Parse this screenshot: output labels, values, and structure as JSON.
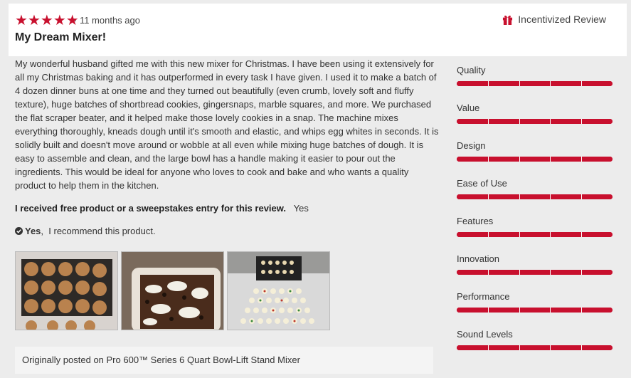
{
  "review": {
    "stars": 5,
    "time": "· 11 months ago",
    "title": "My Dream Mixer!",
    "incentivized_label": "Incentivized Review",
    "body": "My wonderful husband gifted me with this new mixer for Christmas. I have been using it extensively for all my Christmas baking and it has outperformed in every task I have given. I used it to make a batch of 4 dozen dinner buns at one time and they turned out beautifully (even crumb, lovely soft and fluffy texture), huge batches of shortbread cookies, gingersnaps, marble squares, and more. We purchased the flat scraper beater, and it helped make those lovely cookies in a snap. The machine mixes everything thoroughly, kneads dough until it's smooth and elastic, and whips egg whites in seconds. It is solidly built and doesn't move around or wobble at all even while mixing huge batches of dough. It is easy to assemble and clean, and the large bowl has a handle making it easier to pour out the ingredients. This would be ideal for anyone who loves to cook and bake and who wants a quality product to help them in the kitchen.",
    "disclosure_label": "I received free product or a sweepstakes entry for this review.",
    "disclosure_value": "Yes",
    "recommend_yes": "Yes",
    "recommend_text": "I recommend this product.",
    "origin": "Originally posted on Pro 600™ Series 6 Quart Bowl-Lift Stand Mixer"
  },
  "ratings": [
    {
      "label": "Quality",
      "value": 5
    },
    {
      "label": "Value",
      "value": 5
    },
    {
      "label": "Design",
      "value": 5
    },
    {
      "label": "Ease of Use",
      "value": 5
    },
    {
      "label": "Features",
      "value": 5
    },
    {
      "label": "Innovation",
      "value": 5
    },
    {
      "label": "Performance",
      "value": 5
    },
    {
      "label": "Sound Levels",
      "value": 5
    }
  ],
  "rating_max": 5,
  "colors": {
    "accent": "#c8102e",
    "background": "#ececec",
    "card": "#ffffff"
  },
  "icons": {
    "star": "star-icon",
    "gift": "gift-icon",
    "check": "check-circle-icon"
  }
}
